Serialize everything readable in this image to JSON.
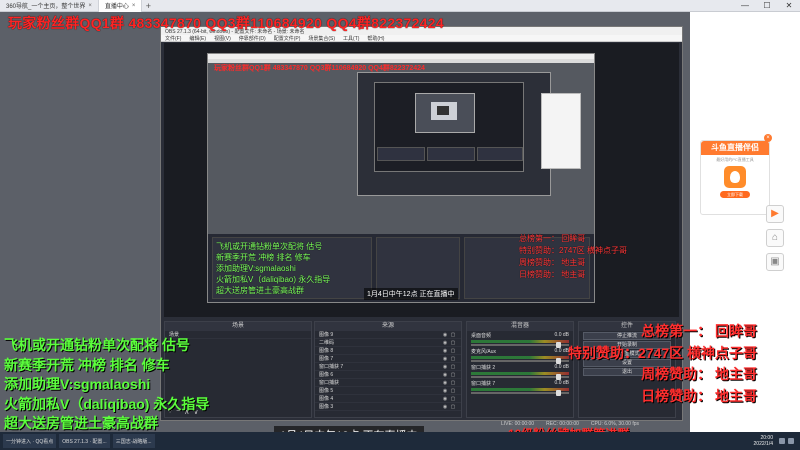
{
  "browser": {
    "tabs": [
      {
        "label": "360导航_一个主页，整个世界",
        "active": false
      },
      {
        "label": "直播中心",
        "active": true
      }
    ],
    "new_tab_label": "+"
  },
  "overlay": {
    "title": "玩家粉丝群QQ1群 483347870 QQ3群110684920 QQ4群822372424",
    "green_lines": [
      "飞机或开通钻粉单次配将 估号",
      "新赛季开荒  冲榜  排名 修车",
      "添加助理V:sgmalaoshi",
      "火箭加私V（daliqibao) 永久指导",
      "超大送房管进土豪高战群"
    ],
    "red_lines": [
      "总榜第一：  回眸哥",
      "特别赞助：2747区  横神点子哥",
      "周榜赞助：  地主哥",
      "日榜赞助：  地主哥"
    ],
    "caption": "1月4日中午12点   正在直播中",
    "bottom_red": "10级粉丝牌加群管进群",
    "mid_title": "玩家粉丝群QQ1群 483347870 QQ3群110684920 QQ4群822372424",
    "mid_caption": "1月4日中午12点   正在直播中"
  },
  "obs": {
    "title": "OBS 27.1.3 (64-bit, windows) - 配置文件: 未命名 - 场景: 未命名",
    "menu": [
      "文件(F)",
      "编辑(E)",
      "视图(V)",
      "停靠部件(D)",
      "配置文件(P)",
      "场景集合(S)",
      "工具(T)",
      "帮助(H)"
    ],
    "docks": {
      "scenes": {
        "title": "场景",
        "items": [
          "场景"
        ]
      },
      "sources": {
        "title": "来源",
        "items": [
          "图像 9",
          "二维码",
          "图像 8",
          "图像 7",
          "窗口捕获 7",
          "图像 6",
          "窗口捕获",
          "图像 5",
          "图像 4",
          "图像 3",
          "图像 2"
        ]
      },
      "mixer": {
        "title": "混音器",
        "channels": [
          {
            "name": "桌面音频",
            "level": "0.0 dB"
          },
          {
            "name": "麦克风/Aux",
            "level": "0.0 dB"
          },
          {
            "name": "窗口捕获 2",
            "level": "0.0 dB"
          },
          {
            "name": "窗口捕获 7",
            "level": "0.0 dB"
          }
        ]
      },
      "controls": {
        "title": "控件",
        "buttons": [
          "停止推流",
          "开始录制",
          "工作室模式",
          "设置",
          "退出"
        ]
      }
    },
    "status": [
      "LIVE: 00:00:00",
      "REC: 00:00:00",
      "CPU: 6.0%, 30.00 fps"
    ]
  },
  "ad": {
    "title": "斗鱼直播伴侣",
    "subtitle": "最好用的PC直播工具",
    "button": "立即下载",
    "close": "×"
  },
  "side_icons": [
    "play-icon",
    "home-icon",
    "screenshot-icon"
  ],
  "taskbar": {
    "items": [
      "一分钟进入 · QQ看点",
      "OBS 27.1.3 · 配置...",
      "三国志·战略版..."
    ],
    "time": "20:00",
    "date": "2022/1/4"
  },
  "colors": {
    "overlay_red": "#ff2424",
    "overlay_green": "#5bff3c",
    "accent_orange": "#ff7a2f"
  }
}
